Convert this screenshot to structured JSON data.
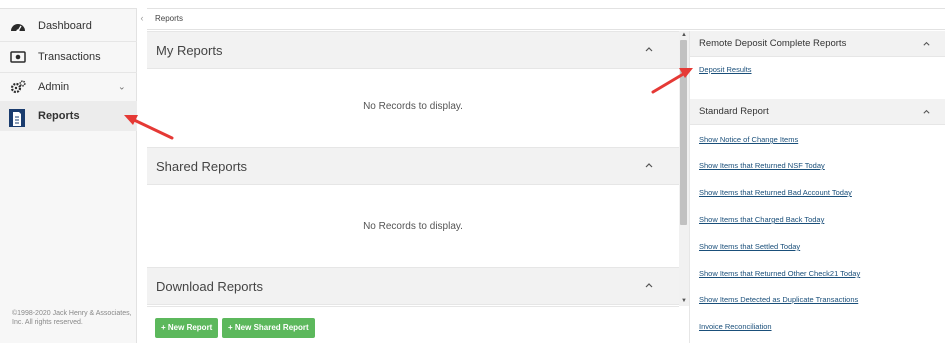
{
  "sidebar": {
    "items": [
      {
        "label": "Dashboard"
      },
      {
        "label": "Transactions"
      },
      {
        "label": "Admin"
      },
      {
        "label": "Reports"
      }
    ],
    "copyright": "©1998-2020 Jack Henry & Associates, Inc. All rights reserved."
  },
  "breadcrumb": "Reports",
  "main": {
    "sections": [
      {
        "title": "My Reports",
        "empty_text": "No Records to display."
      },
      {
        "title": "Shared Reports",
        "empty_text": "No Records to display."
      },
      {
        "title": "Download Reports"
      }
    ],
    "buttons": {
      "new_report": "+ New Report",
      "new_shared_report": "+ New Shared Report"
    }
  },
  "right": {
    "rdc": {
      "title": "Remote Deposit Complete Reports",
      "links": [
        "Deposit Results"
      ]
    },
    "standard": {
      "title": "Standard Report",
      "links": [
        "Show Notice of Change Items",
        "Show Items that Returned NSF Today",
        "Show Items that Returned Bad Account Today",
        "Show Items that Charged Back Today",
        "Show Items that Settled Today",
        "Show Items that Returned Other Check21 Today",
        "Show Items Detected as Duplicate Transactions",
        "Invoice Reconciliation"
      ]
    }
  },
  "colors": {
    "accent_green": "#5cb85c",
    "link_blue": "#1a4f7a",
    "active_icon": "#1a3c6e",
    "annotation_red": "#e53935"
  }
}
